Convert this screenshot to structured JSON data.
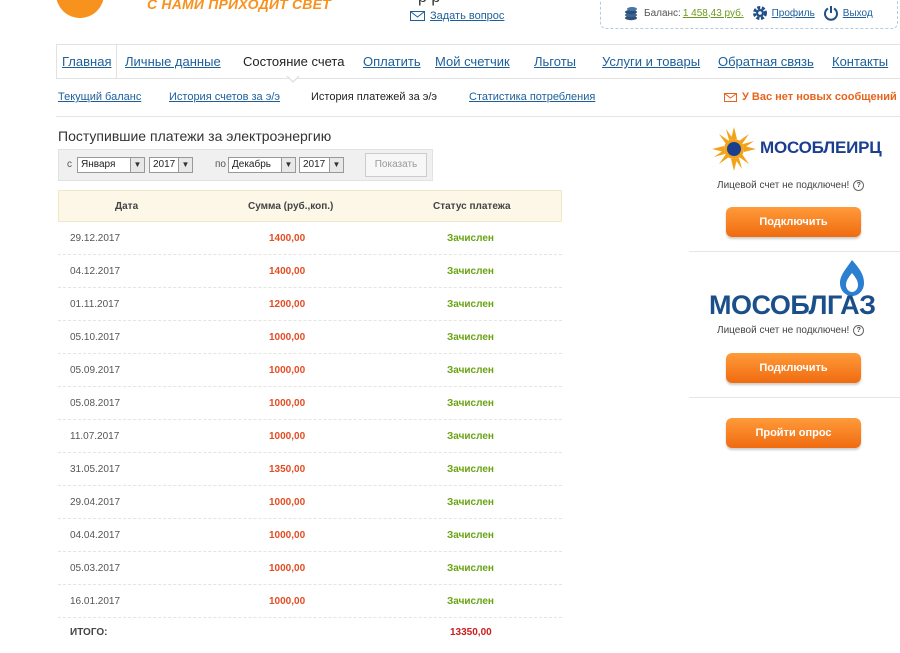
{
  "header": {
    "slogan": "С НАМИ ПРИХОДИТ СВЕТ",
    "cut_text": "р р",
    "ask_question": "Задать вопрос",
    "balance_label": "Баланс:",
    "balance_value": "1 458,43 руб.",
    "profile": "Профиль",
    "logout": "Выход"
  },
  "main_nav": [
    "Главная",
    "Личные данные",
    "Состояние счета",
    "Оплатить",
    "Мой счетчик",
    "Льготы",
    "Услуги и товары",
    "Обратная связь",
    "Контакты"
  ],
  "sub_nav": [
    "Текущий баланс",
    "История счетов за э/э",
    "История платежей за э/э",
    "Статистика потребления"
  ],
  "messages": "У Вас нет новых сообщений",
  "section_title": "Поступившие платежи за электроэнергию",
  "filter": {
    "from_label": "с",
    "from_month": "Января",
    "from_year": "2017",
    "to_label": "по",
    "to_month": "Декабрь",
    "to_year": "2017",
    "show_button": "Показать"
  },
  "table": {
    "headers": [
      "Дата",
      "Сумма (руб.,коп.)",
      "Статус платежа"
    ],
    "rows": [
      {
        "date": "29.12.2017",
        "sum": "1400,00",
        "status": "Зачислен"
      },
      {
        "date": "04.12.2017",
        "sum": "1400,00",
        "status": "Зачислен"
      },
      {
        "date": "01.11.2017",
        "sum": "1200,00",
        "status": "Зачислен"
      },
      {
        "date": "05.10.2017",
        "sum": "1000,00",
        "status": "Зачислен"
      },
      {
        "date": "05.09.2017",
        "sum": "1000,00",
        "status": "Зачислен"
      },
      {
        "date": "05.08.2017",
        "sum": "1000,00",
        "status": "Зачислен"
      },
      {
        "date": "11.07.2017",
        "sum": "1000,00",
        "status": "Зачислен"
      },
      {
        "date": "31.05.2017",
        "sum": "1350,00",
        "status": "Зачислен"
      },
      {
        "date": "29.04.2017",
        "sum": "1000,00",
        "status": "Зачислен"
      },
      {
        "date": "04.04.2017",
        "sum": "1000,00",
        "status": "Зачислен"
      },
      {
        "date": "05.03.2017",
        "sum": "1000,00",
        "status": "Зачислен"
      },
      {
        "date": "16.01.2017",
        "sum": "1000,00",
        "status": "Зачислен"
      }
    ],
    "total_label": "ИТОГО:",
    "total_value": "13350,00"
  },
  "right_column": {
    "eirc_logo": "МОСОБЛЕИРЦ",
    "eirc_note": "Лицевой счет не подключен!",
    "eirc_button": "Подключить",
    "gaz_logo": "МОСОБЛГАЗ",
    "gaz_note": "Лицевой счет не подключен!",
    "gaz_button": "Подключить",
    "survey_button": "Пройти опрос"
  },
  "colors": {
    "accent_orange": "#f7921e",
    "link_blue": "#1d5f9a",
    "sum_red": "#e44c24",
    "status_green": "#6aa312",
    "total_red": "#cc1b1b"
  }
}
